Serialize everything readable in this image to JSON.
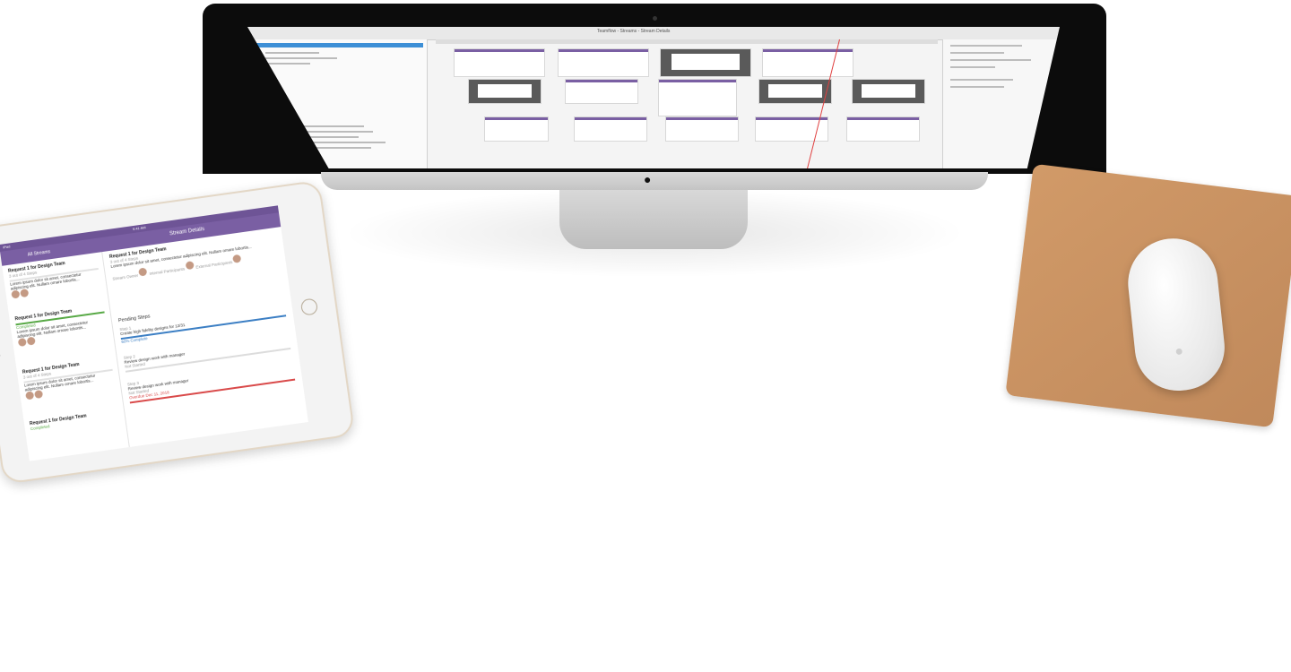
{
  "imac": {
    "window_title": "Teamflow - Streams - Stream Details",
    "apple_logo": "apple-logo",
    "artboard_colors": {
      "header": "#7a5fa3",
      "dark": "#5a5a5a"
    }
  },
  "ipad": {
    "status_left": "iPad",
    "status_time": "9:41 AM",
    "nav_title": "Stream Details",
    "nav_left": "All Streams",
    "list": [
      {
        "title": "Request 1 for Design Team",
        "meta": "3 out of 4 Steps",
        "due": "Due Feb 8",
        "body": "Lorem ipsum dolor sit amet, consectetur adipiscing elit. Nullam ornare lobortis...",
        "progress": "grey"
      },
      {
        "title": "Request 1 for Design Team",
        "meta": "Completed",
        "due": "Due Feb 8",
        "body": "Lorem ipsum dolor sit amet, consectetur adipiscing elit. Nullam ornare lobortis...",
        "progress": "green"
      },
      {
        "title": "Request 1 for Design Team",
        "meta": "3 out of 4 Steps",
        "due": "Due Feb 8",
        "body": "Lorem ipsum dolor sit amet, consectetur adipiscing elit. Nullam ornare lobortis...",
        "progress": "grey"
      },
      {
        "title": "Request 1 for Design Team",
        "meta": "Completed",
        "due": "Due Feb 8",
        "body": "",
        "progress": "green"
      }
    ],
    "detail": {
      "title": "Request 1 for Design Team",
      "meta": "3 out of 4 Steps",
      "due": "Due Feb 8",
      "body": "Lorem ipsum dolor sit amet, consectetur adipiscing elit. Nullam ornare lobortis...",
      "roles": [
        "Stream Owner",
        "Internal Participants",
        "External Participants"
      ],
      "section": "Pending Steps",
      "steps": [
        {
          "label": "Step 1",
          "title": "Create high fidelity designs for 12/31",
          "status": "60% Complete",
          "due": "Due Feb 28",
          "bar": "blue"
        },
        {
          "label": "Step 2",
          "title": "Review design work with manager",
          "status": "Not Started",
          "due": "Due Dec 28",
          "bar": "grey"
        },
        {
          "label": "Step 3",
          "title": "Review design work with manager",
          "status": "Not Started",
          "due": "Overdue Dec 11, 2018",
          "bar": "red"
        }
      ]
    }
  },
  "mouse": {
    "logo": "apple-logo"
  }
}
